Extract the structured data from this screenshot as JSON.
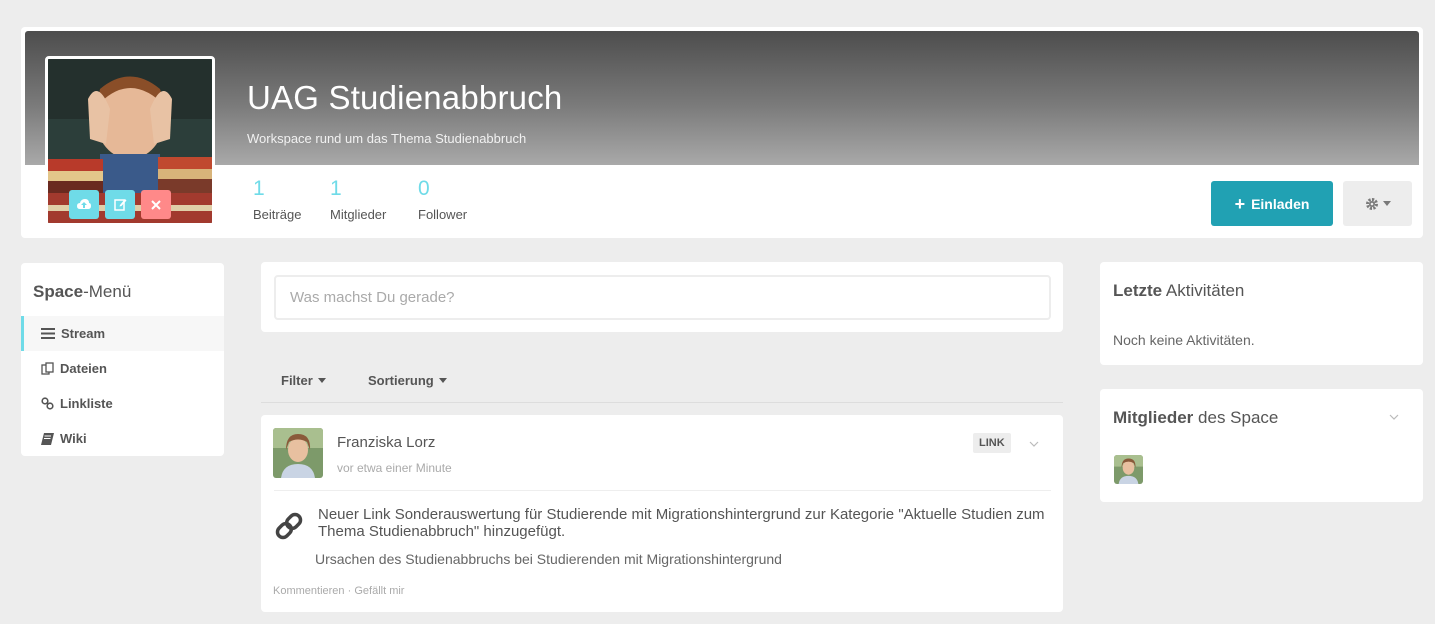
{
  "header": {
    "title": "UAG Studienabbruch",
    "description": "Workspace rund um das Thema Studienabbruch",
    "stats": [
      {
        "value": "1",
        "label": "Beiträge"
      },
      {
        "value": "1",
        "label": "Mitglieder"
      },
      {
        "value": "0",
        "label": "Follower"
      }
    ],
    "invite_label": "Einladen",
    "icons": {
      "upload": "cloud-upload-icon",
      "edit": "edit-icon",
      "delete": "close-icon",
      "settings": "gear-icon"
    }
  },
  "sidemenu": {
    "title_bold": "Space",
    "title_rest": "-Menü",
    "items": [
      {
        "label": "Stream",
        "icon": "list-icon",
        "active": true
      },
      {
        "label": "Dateien",
        "icon": "files-icon",
        "active": false
      },
      {
        "label": "Linkliste",
        "icon": "link-icon",
        "active": false
      },
      {
        "label": "Wiki",
        "icon": "book-icon",
        "active": false
      }
    ]
  },
  "composer": {
    "placeholder": "Was machst Du gerade?"
  },
  "filters": {
    "filter_label": "Filter",
    "sort_label": "Sortierung"
  },
  "post": {
    "author": "Franziska Lorz",
    "time": "vor etwa einer Minute",
    "badge": "LINK",
    "text": "Neuer Link Sonderauswertung für Studierende mit Migrationshintergrund zur Kategorie \"Aktuelle Studien zum Thema Studienabbruch\" hinzugefügt.",
    "subtitle": "Ursachen des Studienabbruchs bei Studierenden mit Migrationshintergrund",
    "comment_label": "Kommentieren",
    "separator": "·",
    "like_label": "Gefällt mir"
  },
  "activities": {
    "title_bold": "Letzte",
    "title_rest": "Aktivitäten",
    "empty_text": "Noch keine Aktivitäten."
  },
  "members": {
    "title_bold": "Mitglieder",
    "title_rest": "des Space"
  },
  "colors": {
    "accent": "#6fdbe8",
    "primary": "#21a1b3",
    "danger": "#ff8989",
    "background": "#ededed"
  }
}
